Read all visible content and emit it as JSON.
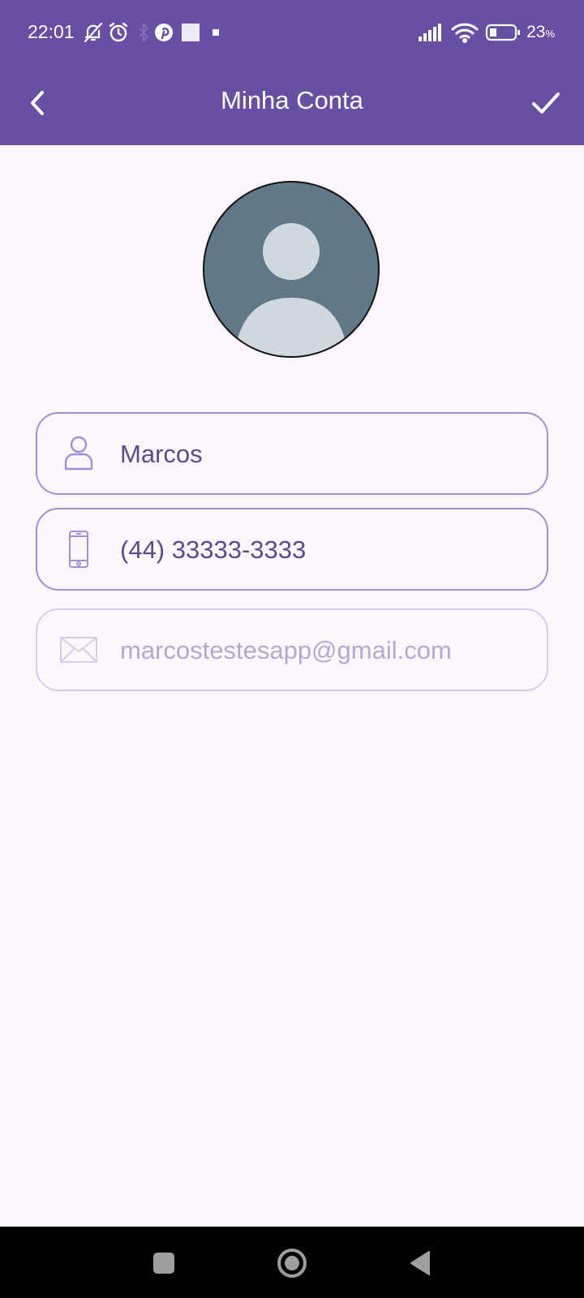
{
  "status_bar": {
    "time": "22:01",
    "battery_percent": "23",
    "battery_symbol": "%"
  },
  "header": {
    "title": "Minha Conta"
  },
  "form": {
    "name": "Marcos",
    "phone": "(44) 33333-3333",
    "email": "marcostestesapp@gmail.com"
  },
  "colors": {
    "primary": "#6750a4",
    "background": "#fdf7fd",
    "field_border": "#a28fd6",
    "field_text": "#5b4a8c",
    "avatar_bg": "#617886",
    "avatar_fg": "#cfd8dc"
  },
  "icons": {
    "back": "chevron-left-icon",
    "save": "check-icon",
    "name": "user-icon",
    "phone": "smartphone-icon",
    "email": "mail-icon"
  }
}
